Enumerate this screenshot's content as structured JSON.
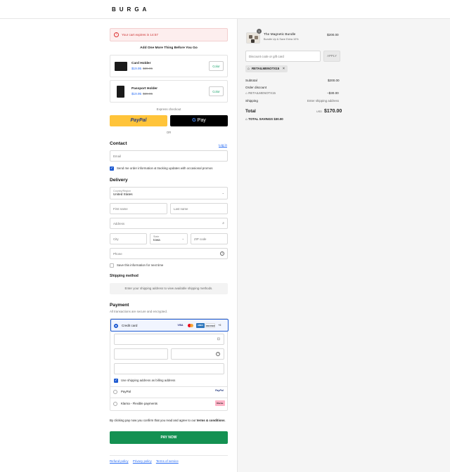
{
  "brand": {
    "logo": "BURGA"
  },
  "cart_timer": {
    "text": "Your cart expires in 14:57"
  },
  "upsell": {
    "title": "Add One More Thing Before You Go",
    "items": [
      {
        "name": "Card Holder",
        "price": "$19.95",
        "old_price": "$39.95",
        "button": "Color"
      },
      {
        "name": "Passport Holder",
        "price": "$19.95",
        "old_price": "$39.95",
        "button": "Color"
      }
    ]
  },
  "express": {
    "label": "Express checkout",
    "paypal": "PayPal",
    "gpay_g": "G",
    "gpay": "Pay",
    "or": "OR"
  },
  "contact": {
    "heading": "Contact",
    "login": "Log in",
    "email_placeholder": "Email",
    "newsletter_label": "Send me order information & tracking updates with occasional promos"
  },
  "delivery": {
    "heading": "Delivery",
    "country_label": "Country/Region",
    "country_value": "United States",
    "first_name": "First name",
    "last_name": "Last name",
    "address": "Address",
    "city": "City",
    "state_label": "State",
    "state_value": "Iowa",
    "zip": "ZIP code",
    "phone": "Phone",
    "save_info": "Save this information for next time"
  },
  "shipping": {
    "heading": "Shipping method",
    "note": "Enter your shipping address to view available shipping methods."
  },
  "payment": {
    "heading": "Payment",
    "subtitle": "All transactions are secure and encrypted.",
    "credit_card": "Credit card",
    "card_brands": [
      "VISA",
      "MC",
      "AMEX",
      "DISCOVER",
      "+2"
    ],
    "billing_same": "Use shipping address as billing address",
    "paypal": "PayPal",
    "klarna": "Klarna - Flexible payments",
    "paypal_logo": "PayPal",
    "klarna_logo": "Klarna."
  },
  "consent": {
    "text": "By clicking pay now you confirm that you read and agree to our",
    "terms": "terms & conditions",
    "period": "."
  },
  "pay_now": "PAY NOW",
  "footer": {
    "refund": "Refund policy",
    "privacy": "Privacy policy",
    "terms": "Terms of service"
  },
  "summary": {
    "quantity": "1",
    "product_name": "The Magnetic Bundle",
    "product_variant": "Bundle Up & Save Extra 10%",
    "product_price": "$200.00",
    "discount_placeholder": "Discount code or gift card",
    "apply": "APPLY",
    "applied_code": "RETAILMENOTX15",
    "subtotal_label": "Subtotal",
    "subtotal_value": "$200.00",
    "order_discount_label": "Order discount",
    "discount_code": "RETAILMENOTX15",
    "discount_value": "−$30.00",
    "shipping_label": "Shipping",
    "shipping_value": "Enter shipping address",
    "total_label": "Total",
    "currency": "USD",
    "total_value": "$170.00",
    "savings_label": "TOTAL SAVINGS",
    "savings_value": "$30.00"
  }
}
